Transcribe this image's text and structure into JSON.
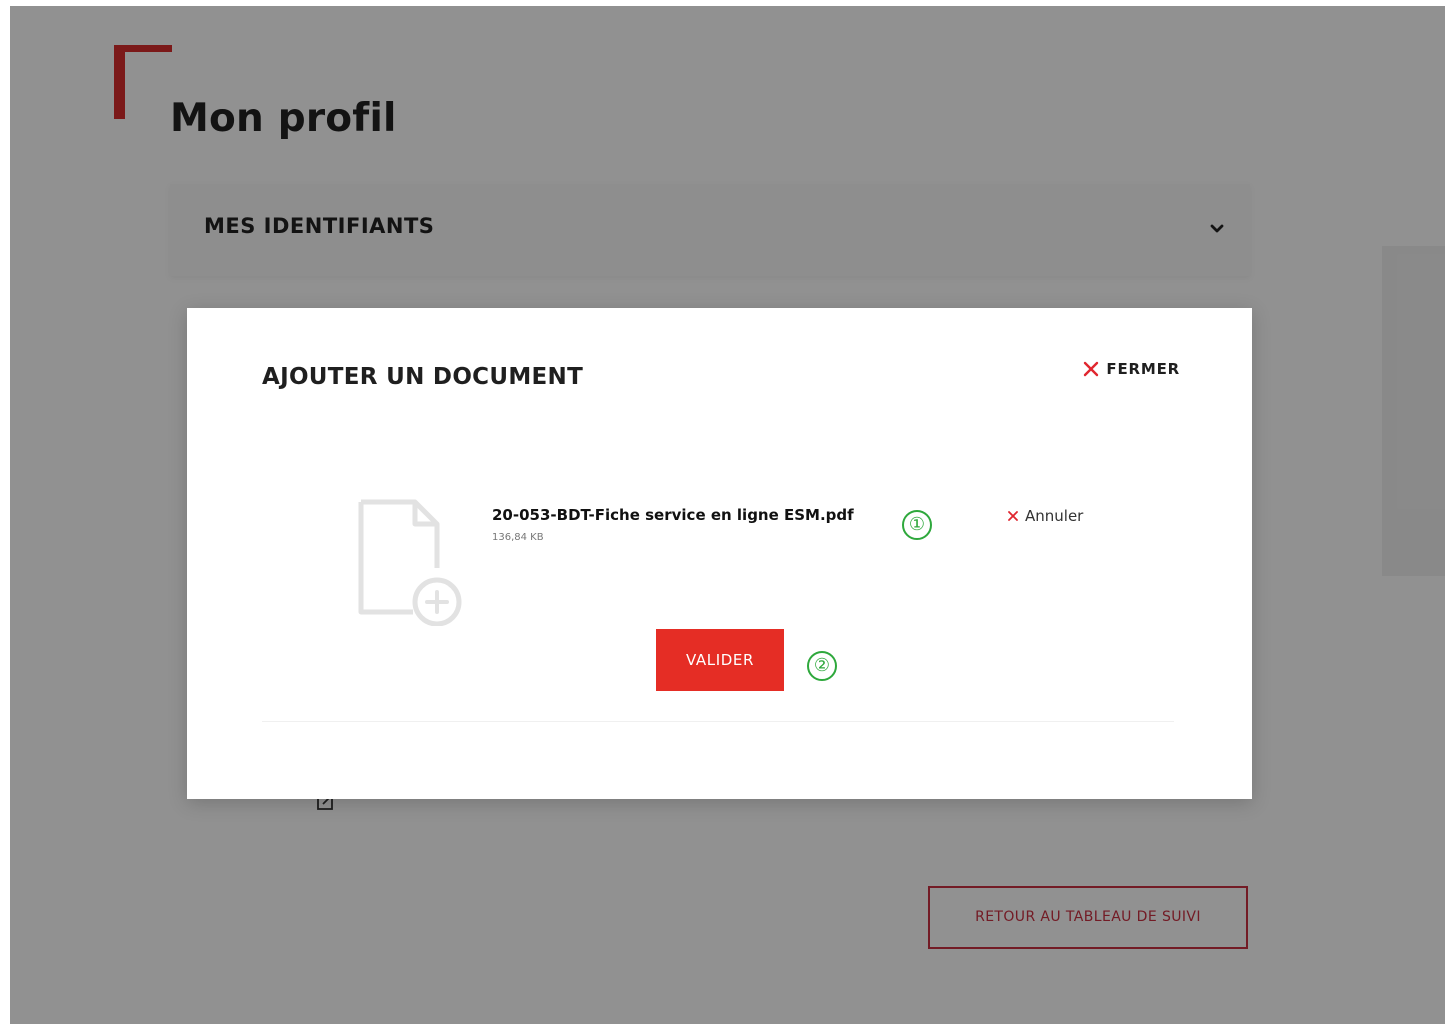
{
  "page": {
    "title": "Mon profil",
    "accordion_label": "MES IDENTIFIANTS",
    "back_button_label": "RETOUR AU TABLEAU DE SUIVI"
  },
  "modal": {
    "title": "AJOUTER UN DOCUMENT",
    "close_label": "FERMER",
    "file": {
      "name": "20-053-BDT-Fiche service en ligne ESM.pdf",
      "size": "136,84 KB"
    },
    "cancel_label": "Annuler",
    "validate_label": "VALIDER"
  },
  "annotations": {
    "step_1": "①",
    "step_2": "②"
  },
  "colors": {
    "brand_red": "#d42b2b",
    "button_red": "#e52d25",
    "callout_green": "#2ea83c",
    "back_button_border": "#c73040"
  },
  "icons": {
    "accordion": "chevron-down-icon",
    "close": "close-icon",
    "cancel": "cancel-icon",
    "document": "document-add-icon",
    "edit": "edit-icon"
  }
}
